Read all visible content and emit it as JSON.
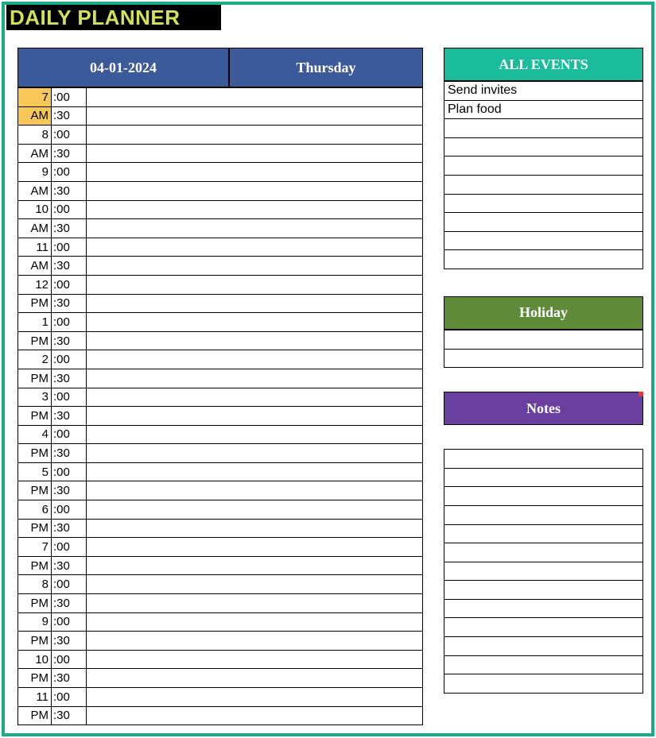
{
  "title": "DAILY PLANNER",
  "date": "04-01-2024",
  "day": "Thursday",
  "events_header": "ALL EVENTS",
  "holiday_header": "Holiday",
  "notes_header": "Notes",
  "events": [
    "Send invites",
    "Plan food",
    "",
    "",
    "",
    "",
    "",
    "",
    "",
    ""
  ],
  "holiday": [
    "",
    ""
  ],
  "notes": [
    "",
    "",
    "",
    "",
    "",
    "",
    "",
    "",
    "",
    "",
    "",
    "",
    ""
  ],
  "schedule": [
    {
      "hour": "7",
      "ampm": "AM",
      "highlight": true
    },
    {
      "hour": "8",
      "ampm": "AM",
      "highlight": false
    },
    {
      "hour": "9",
      "ampm": "AM",
      "highlight": false
    },
    {
      "hour": "10",
      "ampm": "AM",
      "highlight": false
    },
    {
      "hour": "11",
      "ampm": "AM",
      "highlight": false
    },
    {
      "hour": "12",
      "ampm": "PM",
      "highlight": false
    },
    {
      "hour": "1",
      "ampm": "PM",
      "highlight": false
    },
    {
      "hour": "2",
      "ampm": "PM",
      "highlight": false
    },
    {
      "hour": "3",
      "ampm": "PM",
      "highlight": false
    },
    {
      "hour": "4",
      "ampm": "PM",
      "highlight": false
    },
    {
      "hour": "5",
      "ampm": "PM",
      "highlight": false
    },
    {
      "hour": "6",
      "ampm": "PM",
      "highlight": false
    },
    {
      "hour": "7",
      "ampm": "PM",
      "highlight": false
    },
    {
      "hour": "8",
      "ampm": "PM",
      "highlight": false
    },
    {
      "hour": "9",
      "ampm": "PM",
      "highlight": false
    },
    {
      "hour": "10",
      "ampm": "PM",
      "highlight": false
    },
    {
      "hour": "11",
      "ampm": "PM",
      "highlight": false
    }
  ],
  "minute_labels": {
    "top": ":00",
    "bottom": ":30"
  }
}
